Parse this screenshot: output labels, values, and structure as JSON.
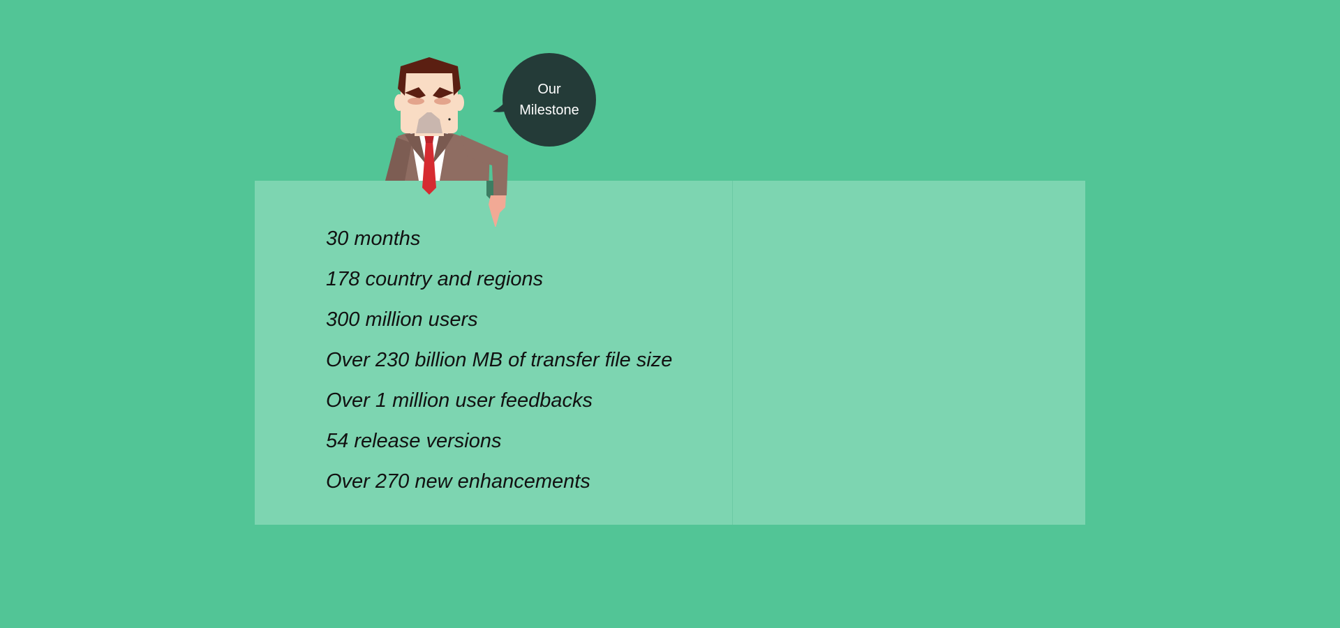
{
  "bubble": {
    "line1": "Our",
    "line2": "Milestone"
  },
  "milestones": [
    "30 months",
    "178 country and regions",
    "300 million users",
    "Over 230 billion MB of transfer file size",
    "Over 1 million user feedbacks",
    "54 release versions",
    "Over 270 new enhancements"
  ],
  "colors": {
    "background": "#52c596",
    "board": "#7dd5b1",
    "bubble": "#243b38",
    "text": "#111111"
  },
  "icons": {
    "mascot": "businessman-mascot-icon"
  }
}
